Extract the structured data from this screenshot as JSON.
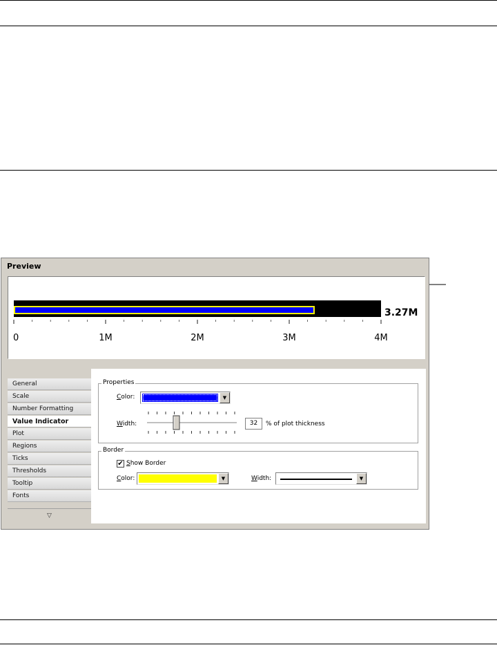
{
  "dialog": {
    "preview_title": "Preview",
    "gauge": {
      "value_label": "3.27M",
      "value": 3.27,
      "max": 4,
      "tick_labels": [
        "0",
        "1M",
        "2M",
        "3M",
        "4M"
      ],
      "colors": {
        "background": "#000000",
        "indicator_fill": "#0000ff",
        "indicator_border": "#ffff00"
      }
    }
  },
  "nav": {
    "items": [
      {
        "label": "General"
      },
      {
        "label": "Scale"
      },
      {
        "label": "Number Formatting"
      },
      {
        "label": "Value Indicator"
      },
      {
        "label": "Plot"
      },
      {
        "label": "Regions"
      },
      {
        "label": "Ticks"
      },
      {
        "label": "Thresholds"
      },
      {
        "label": "Tooltip"
      },
      {
        "label": "Fonts"
      }
    ],
    "active": "Value Indicator",
    "scroll_icon": "scroll-down-icon"
  },
  "properties": {
    "group_label": "Properties",
    "color_label_first": "C",
    "color_label_rest": "olor:",
    "color_value": "#0000ff",
    "width_label_first": "W",
    "width_label_rest": "idth:",
    "width_percent": "32",
    "width_suffix": "% of plot thickness"
  },
  "border": {
    "group_label": "Border",
    "show_border_first": "S",
    "show_border_rest": "how Border",
    "show_border_checked": "✔",
    "color_label_first": "C",
    "color_label_rest": "olor:",
    "color_value": "#ffff00",
    "width_label_first": "W",
    "width_label_rest": "idth:"
  }
}
